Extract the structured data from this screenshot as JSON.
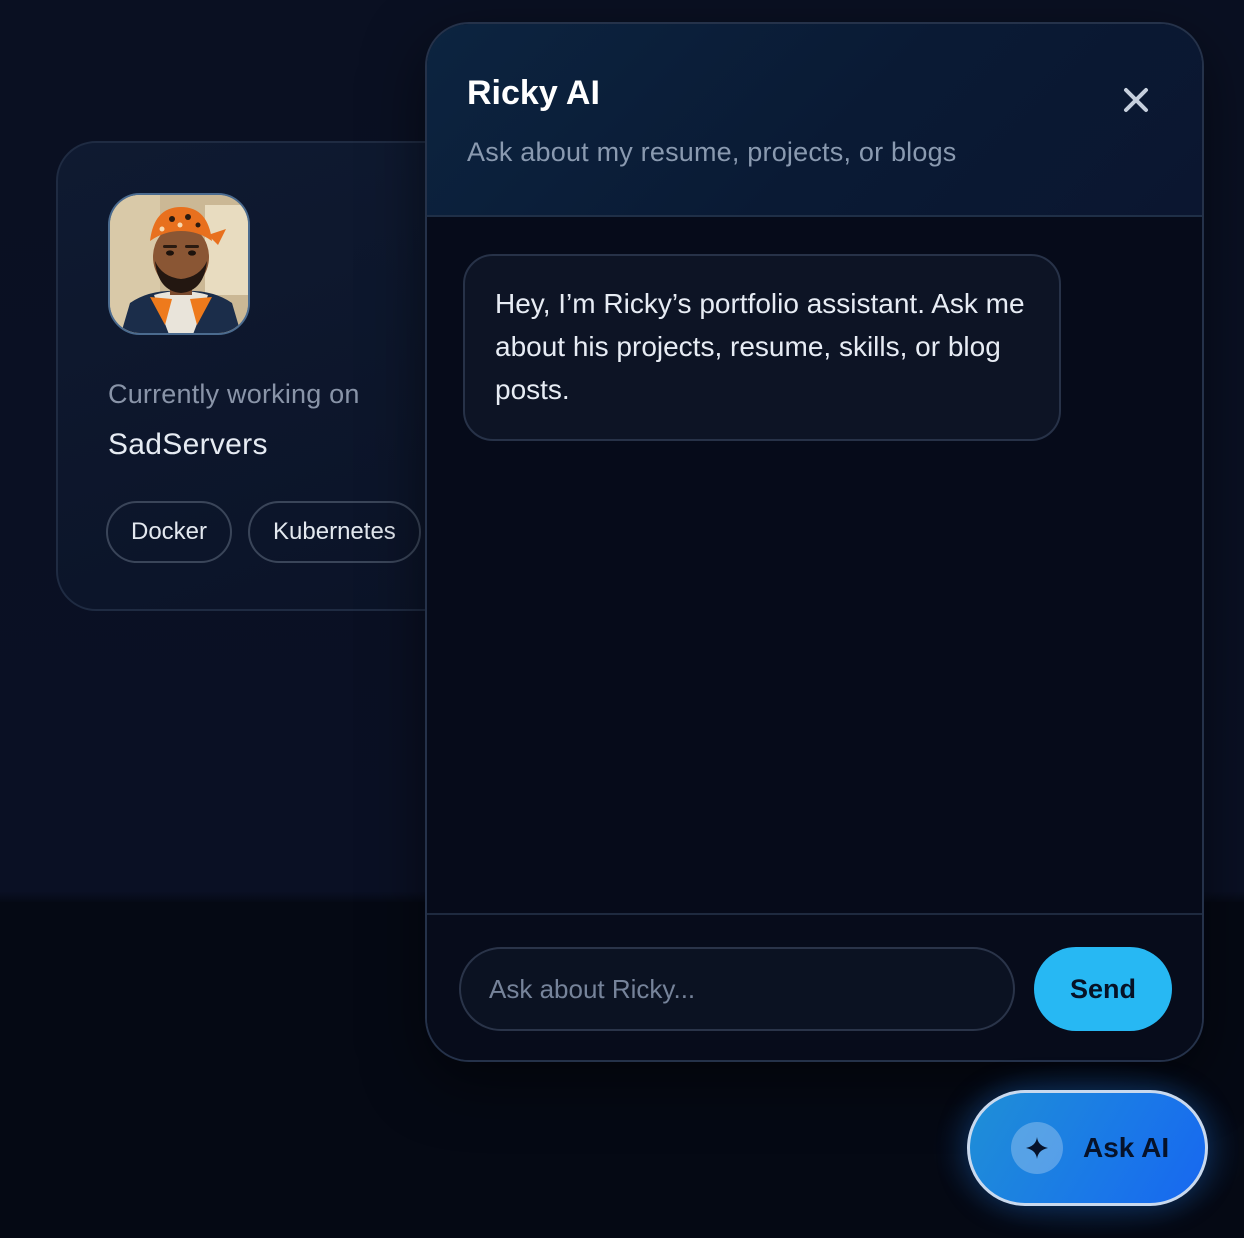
{
  "profile": {
    "working_label": "Currently working on",
    "working_value": "SadServers",
    "tags": [
      "Docker",
      "Kubernetes"
    ]
  },
  "chat": {
    "title": "Ricky AI",
    "subtitle": "Ask about my resume, projects, or blogs",
    "messages": [
      {
        "role": "assistant",
        "text": "Hey, I’m Ricky’s portfolio assistant. Ask me about his projects, resume, skills, or blog posts."
      }
    ],
    "input": {
      "placeholder": "Ask about Ricky...",
      "value": ""
    },
    "send_label": "Send"
  },
  "launcher": {
    "label": "Ask AI",
    "icon": "sparkle-icon"
  },
  "colors": {
    "accent": "#27b8f3",
    "launcher": "#1a78e8",
    "background": "#070b18"
  }
}
